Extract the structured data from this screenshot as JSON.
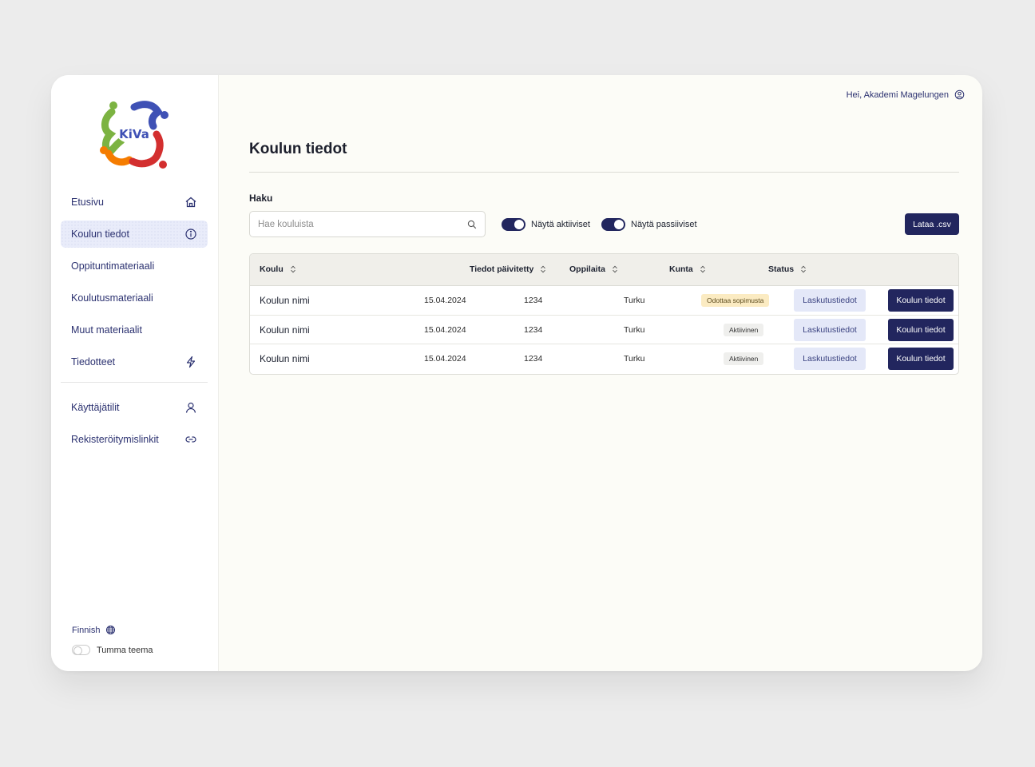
{
  "brand": {
    "logo_text": "KiVa"
  },
  "sidebar": {
    "items": [
      {
        "label": "Etusivu",
        "icon": "home-icon"
      },
      {
        "label": "Koulun tiedot",
        "icon": "info-icon",
        "active": true
      },
      {
        "label": "Oppituntimateriaali",
        "icon": ""
      },
      {
        "label": "Koulutusmateriaali",
        "icon": ""
      },
      {
        "label": "Muut materiaalit",
        "icon": ""
      },
      {
        "label": "Tiedotteet",
        "icon": "bolt-icon"
      }
    ],
    "admin_items": [
      {
        "label": "Käyttäjätilit",
        "icon": "user-icon"
      },
      {
        "label": "Rekisteröitymislinkit",
        "icon": "link-icon"
      }
    ],
    "language": "Finnish",
    "dark_theme_label": "Tumma teema"
  },
  "header": {
    "greeting": "Hei, Akademi Magelungen"
  },
  "page": {
    "title": "Koulun tiedot",
    "search_label": "Haku",
    "search_placeholder": "Hae kouluista",
    "toggle_active_label": "Näytä aktiiviset",
    "toggle_passive_label": "Näytä passiiviset",
    "csv_button": "Lataa .csv"
  },
  "table": {
    "columns": [
      "Koulu",
      "Tiedot päivitetty",
      "Oppilaita",
      "Kunta",
      "Status"
    ],
    "rows": [
      {
        "name": "Koulun nimi",
        "updated": "15.04.2024",
        "students": "1234",
        "municipality": "Turku",
        "status": "Odottaa sopimusta",
        "status_type": "pending",
        "billing_button": "Laskutustiedot",
        "info_button": "Koulun tiedot"
      },
      {
        "name": "Koulun nimi",
        "updated": "15.04.2024",
        "students": "1234",
        "municipality": "Turku",
        "status": "Aktiivinen",
        "status_type": "active",
        "billing_button": "Laskutustiedot",
        "info_button": "Koulun tiedot"
      },
      {
        "name": "Koulun nimi",
        "updated": "15.04.2024",
        "students": "1234",
        "municipality": "Turku",
        "status": "Aktiivinen",
        "status_type": "active",
        "billing_button": "Laskutustiedot",
        "info_button": "Koulun tiedot"
      }
    ]
  },
  "colors": {
    "primary": "#22265e",
    "nav_text": "#2b3170",
    "active_bg": "#e9ecfa",
    "pending_badge": "#fbebc2",
    "light_button": "#e4e8f8"
  }
}
